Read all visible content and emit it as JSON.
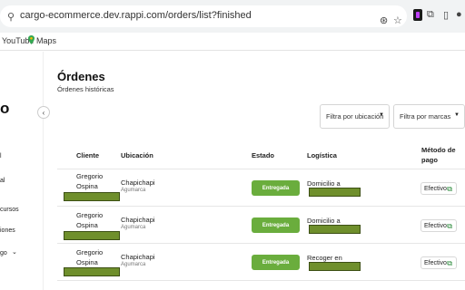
{
  "browser": {
    "url": "cargo-ecommerce.dev.rappi.com/orders/list?finished",
    "site_info_icon": "tune-icon",
    "bookmarks": [
      "YouTube",
      "Maps"
    ]
  },
  "sidebar": {
    "logo": "o",
    "collapse_icon": "chevron-left-icon",
    "items": [
      "l",
      "al",
      "cursos",
      "iones",
      "go"
    ],
    "expand_icon": "chevron-down-icon"
  },
  "page": {
    "title": "Órdenes",
    "subtitle": "Órdenes históricas"
  },
  "filters": {
    "ubicacion": "Filtra por ubicación",
    "marcas": "Filtra por marcas"
  },
  "table": {
    "headers": [
      "Cliente",
      "Ubicación",
      "Estado",
      "Logística",
      "Método de pago"
    ],
    "rows": [
      {
        "cliente": "Gregorio Ospina",
        "ubicacion": "Chapichapi",
        "zona": "Agumarca",
        "estado": "Entregada",
        "logistica": "Domicilio a",
        "pago": "Efectivo"
      },
      {
        "cliente": "Gregorio Ospina",
        "ubicacion": "Chapichapi",
        "zona": "Agumarca",
        "estado": "Entregada",
        "logistica": "Domicilio a",
        "pago": "Efectivo"
      },
      {
        "cliente": "Gregorio Ospina",
        "ubicacion": "Chapichapi",
        "zona": "Agumarca",
        "estado": "Entregada",
        "logistica": "Recoger en",
        "pago": "Efectivo"
      }
    ]
  },
  "colors": {
    "estado_pill": "#6aad3d",
    "redaction": "#6f8f2c"
  }
}
